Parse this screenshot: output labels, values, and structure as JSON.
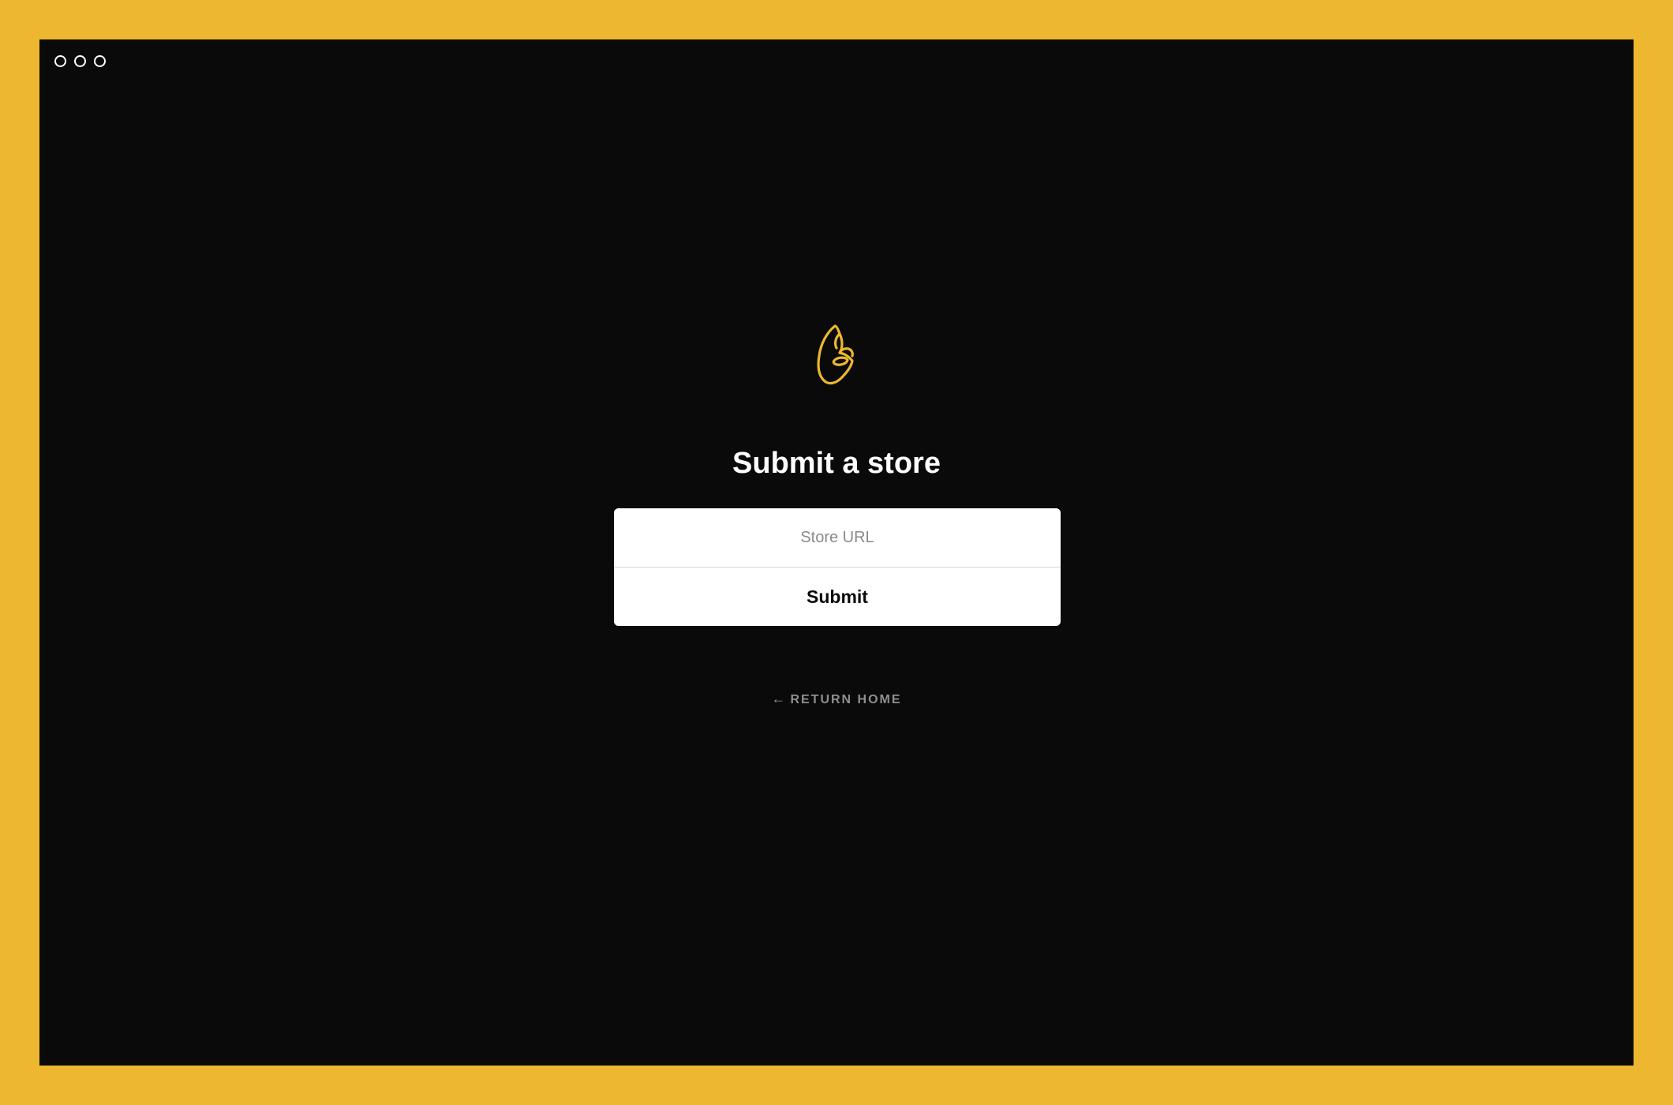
{
  "colors": {
    "frame": "#edb72f",
    "window_background": "#0a0a0a",
    "logo_stroke": "#edb72f",
    "title": "#ffffff",
    "card_background": "#ffffff",
    "link": "#8f8f8f"
  },
  "window": {
    "controls": [
      "close-icon",
      "minimize-icon",
      "maximize-icon"
    ]
  },
  "logo": {
    "icon": "ok-hand-icon"
  },
  "page": {
    "title": "Submit a store"
  },
  "form": {
    "store_url": {
      "value": "",
      "placeholder": "Store URL"
    },
    "submit_label": "Submit"
  },
  "nav": {
    "return_home": {
      "arrow": "←",
      "label": "RETURN HOME"
    }
  }
}
